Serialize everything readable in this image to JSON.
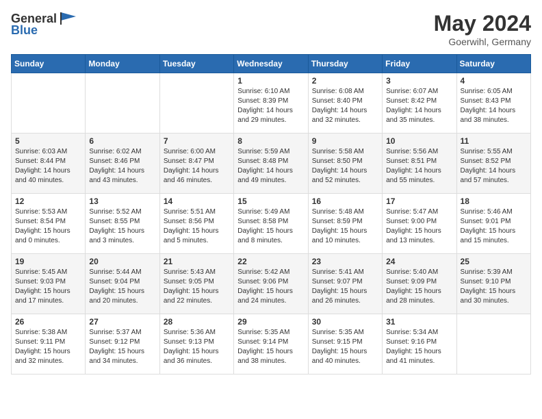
{
  "header": {
    "logo": {
      "text_general": "General",
      "text_blue": "Blue"
    },
    "month_year": "May 2024",
    "location": "Goerwihl, Germany"
  },
  "days_of_week": [
    "Sunday",
    "Monday",
    "Tuesday",
    "Wednesday",
    "Thursday",
    "Friday",
    "Saturday"
  ],
  "weeks": [
    [
      {
        "day": "",
        "info": ""
      },
      {
        "day": "",
        "info": ""
      },
      {
        "day": "",
        "info": ""
      },
      {
        "day": "1",
        "info": "Sunrise: 6:10 AM\nSunset: 8:39 PM\nDaylight: 14 hours\nand 29 minutes."
      },
      {
        "day": "2",
        "info": "Sunrise: 6:08 AM\nSunset: 8:40 PM\nDaylight: 14 hours\nand 32 minutes."
      },
      {
        "day": "3",
        "info": "Sunrise: 6:07 AM\nSunset: 8:42 PM\nDaylight: 14 hours\nand 35 minutes."
      },
      {
        "day": "4",
        "info": "Sunrise: 6:05 AM\nSunset: 8:43 PM\nDaylight: 14 hours\nand 38 minutes."
      }
    ],
    [
      {
        "day": "5",
        "info": "Sunrise: 6:03 AM\nSunset: 8:44 PM\nDaylight: 14 hours\nand 40 minutes."
      },
      {
        "day": "6",
        "info": "Sunrise: 6:02 AM\nSunset: 8:46 PM\nDaylight: 14 hours\nand 43 minutes."
      },
      {
        "day": "7",
        "info": "Sunrise: 6:00 AM\nSunset: 8:47 PM\nDaylight: 14 hours\nand 46 minutes."
      },
      {
        "day": "8",
        "info": "Sunrise: 5:59 AM\nSunset: 8:48 PM\nDaylight: 14 hours\nand 49 minutes."
      },
      {
        "day": "9",
        "info": "Sunrise: 5:58 AM\nSunset: 8:50 PM\nDaylight: 14 hours\nand 52 minutes."
      },
      {
        "day": "10",
        "info": "Sunrise: 5:56 AM\nSunset: 8:51 PM\nDaylight: 14 hours\nand 55 minutes."
      },
      {
        "day": "11",
        "info": "Sunrise: 5:55 AM\nSunset: 8:52 PM\nDaylight: 14 hours\nand 57 minutes."
      }
    ],
    [
      {
        "day": "12",
        "info": "Sunrise: 5:53 AM\nSunset: 8:54 PM\nDaylight: 15 hours\nand 0 minutes."
      },
      {
        "day": "13",
        "info": "Sunrise: 5:52 AM\nSunset: 8:55 PM\nDaylight: 15 hours\nand 3 minutes."
      },
      {
        "day": "14",
        "info": "Sunrise: 5:51 AM\nSunset: 8:56 PM\nDaylight: 15 hours\nand 5 minutes."
      },
      {
        "day": "15",
        "info": "Sunrise: 5:49 AM\nSunset: 8:58 PM\nDaylight: 15 hours\nand 8 minutes."
      },
      {
        "day": "16",
        "info": "Sunrise: 5:48 AM\nSunset: 8:59 PM\nDaylight: 15 hours\nand 10 minutes."
      },
      {
        "day": "17",
        "info": "Sunrise: 5:47 AM\nSunset: 9:00 PM\nDaylight: 15 hours\nand 13 minutes."
      },
      {
        "day": "18",
        "info": "Sunrise: 5:46 AM\nSunset: 9:01 PM\nDaylight: 15 hours\nand 15 minutes."
      }
    ],
    [
      {
        "day": "19",
        "info": "Sunrise: 5:45 AM\nSunset: 9:03 PM\nDaylight: 15 hours\nand 17 minutes."
      },
      {
        "day": "20",
        "info": "Sunrise: 5:44 AM\nSunset: 9:04 PM\nDaylight: 15 hours\nand 20 minutes."
      },
      {
        "day": "21",
        "info": "Sunrise: 5:43 AM\nSunset: 9:05 PM\nDaylight: 15 hours\nand 22 minutes."
      },
      {
        "day": "22",
        "info": "Sunrise: 5:42 AM\nSunset: 9:06 PM\nDaylight: 15 hours\nand 24 minutes."
      },
      {
        "day": "23",
        "info": "Sunrise: 5:41 AM\nSunset: 9:07 PM\nDaylight: 15 hours\nand 26 minutes."
      },
      {
        "day": "24",
        "info": "Sunrise: 5:40 AM\nSunset: 9:09 PM\nDaylight: 15 hours\nand 28 minutes."
      },
      {
        "day": "25",
        "info": "Sunrise: 5:39 AM\nSunset: 9:10 PM\nDaylight: 15 hours\nand 30 minutes."
      }
    ],
    [
      {
        "day": "26",
        "info": "Sunrise: 5:38 AM\nSunset: 9:11 PM\nDaylight: 15 hours\nand 32 minutes."
      },
      {
        "day": "27",
        "info": "Sunrise: 5:37 AM\nSunset: 9:12 PM\nDaylight: 15 hours\nand 34 minutes."
      },
      {
        "day": "28",
        "info": "Sunrise: 5:36 AM\nSunset: 9:13 PM\nDaylight: 15 hours\nand 36 minutes."
      },
      {
        "day": "29",
        "info": "Sunrise: 5:35 AM\nSunset: 9:14 PM\nDaylight: 15 hours\nand 38 minutes."
      },
      {
        "day": "30",
        "info": "Sunrise: 5:35 AM\nSunset: 9:15 PM\nDaylight: 15 hours\nand 40 minutes."
      },
      {
        "day": "31",
        "info": "Sunrise: 5:34 AM\nSunset: 9:16 PM\nDaylight: 15 hours\nand 41 minutes."
      },
      {
        "day": "",
        "info": ""
      }
    ]
  ]
}
